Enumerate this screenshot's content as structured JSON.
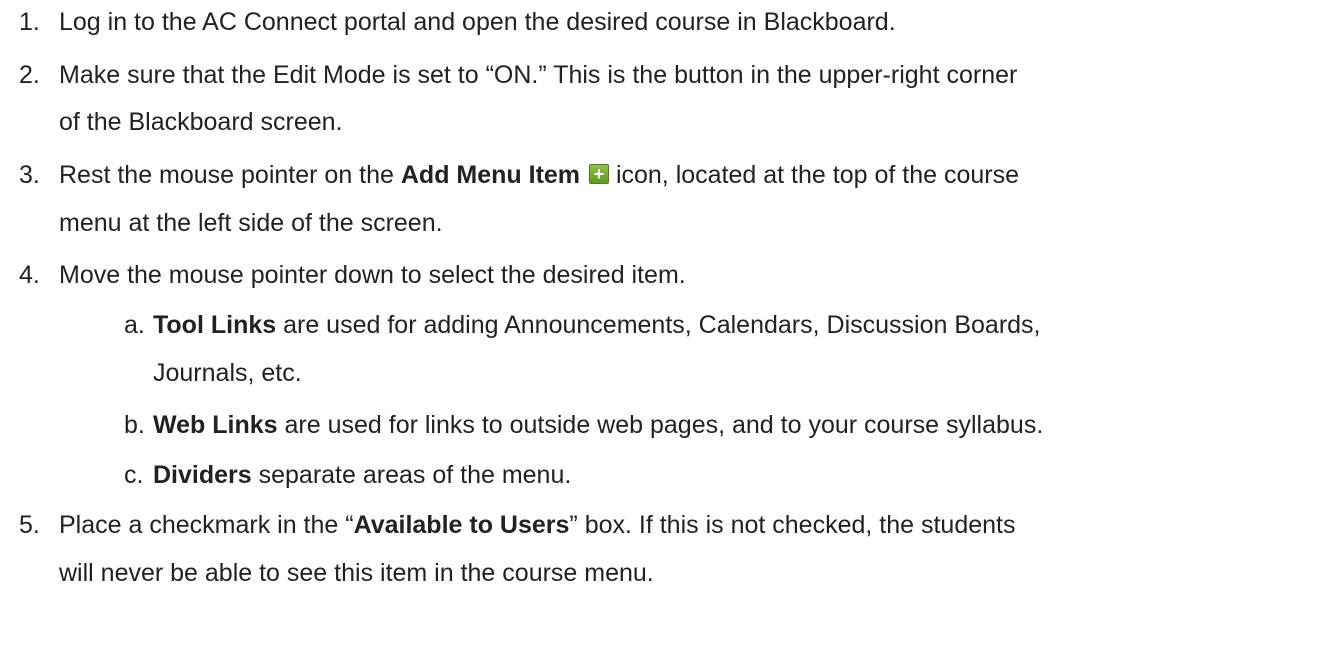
{
  "steps": [
    {
      "num": "1.",
      "lines": [
        [
          "Log in to the AC Connect portal and open the desired course in Blackboard."
        ]
      ]
    },
    {
      "num": "2.",
      "line1": "Make sure that the Edit Mode is set to “ON.”  This is the button in the upper-right corner",
      "line2": "of the Blackboard screen."
    },
    {
      "num": "3.",
      "pre": "Rest the mouse pointer on the ",
      "bold": "Add Menu Item",
      "post": " icon, located at the top of the course",
      "line2": "menu at the left side of the screen.",
      "icon": "plus-icon"
    },
    {
      "num": "4.",
      "text": "Move the mouse pointer down to select the desired item.",
      "sub": [
        {
          "num": "a.",
          "bold": "Tool Links",
          "text": " are used for adding Announcements, Calendars, Discussion Boards,",
          "line2": "Journals, etc."
        },
        {
          "num": "b.",
          "bold": "Web Links",
          "text": " are used for links to outside web pages, and to your course syllabus."
        },
        {
          "num": "c.",
          "bold": "Dividers",
          "text": " separate areas of the menu."
        }
      ]
    },
    {
      "num": "5.",
      "pre": "Place a checkmark in the “",
      "bold": "Available to Users",
      "post": "” box.  If this is not checked, the students",
      "line2": "will never be able to see this item in the course menu."
    }
  ],
  "icon_plus_glyph": "+",
  "colors": {
    "text": "#222222",
    "icon_green": "#6aa52b"
  }
}
